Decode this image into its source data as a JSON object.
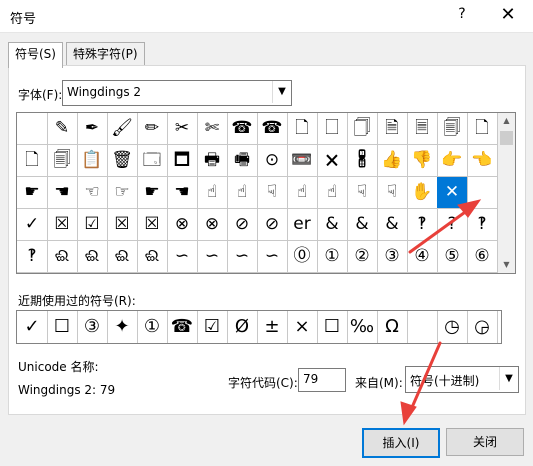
{
  "window": {
    "title": "符号",
    "help": "?",
    "close": "✕"
  },
  "tabs": [
    {
      "label": "符号(S)"
    },
    {
      "label": "特殊字符(P)"
    }
  ],
  "font": {
    "label": "字体(F):",
    "value": "Wingdings 2"
  },
  "grid_rows": [
    [
      "",
      "✎",
      "✒",
      "🖌",
      "✏",
      "✂",
      "✄",
      "☎",
      "☎",
      "🗋",
      "🗌",
      "🗍",
      "🗎",
      "🗏",
      "🗐",
      "🗋"
    ],
    [
      "🗋",
      "🗐",
      "📋",
      "🗑",
      "🗔",
      "🗖",
      "🖶",
      "🖷",
      "⊙",
      "📼",
      "🗙",
      "🖁",
      "👍",
      "👎",
      "👉",
      "👈"
    ],
    [
      "☛",
      "☚",
      "☜",
      "☞",
      "☛",
      "☚",
      "☝",
      "☝",
      "☟",
      "☝",
      "☝",
      "☟",
      "☟",
      "✋",
      "✕",
      ""
    ],
    [
      "✓",
      "☒",
      "☑",
      "☒",
      "☒",
      "⊗",
      "⊗",
      "⊘",
      "⊘",
      "er",
      "&",
      "&",
      "&",
      "‽",
      "?",
      "‽"
    ],
    [
      "‽",
      "ଈ",
      "ଈ",
      "ଈ",
      "ଈ",
      "∽",
      "∽",
      "∽",
      "∽",
      "⓪",
      "①",
      "②",
      "③",
      "④",
      "⑤",
      "⑥"
    ]
  ],
  "recent": {
    "label": "近期使用过的符号(R):",
    "symbols": [
      "✓",
      "☐",
      "③",
      "✦",
      "①",
      "☎",
      "☑",
      "Ø",
      "±",
      "×",
      "☐",
      "‰",
      "Ω",
      "",
      "◷",
      "◶"
    ]
  },
  "unicode": {
    "name_label": "Unicode 名称:",
    "name_value": "Wingdings 2: 79"
  },
  "char_code": {
    "label": "字符代码(C):",
    "value": "79"
  },
  "from": {
    "label": "来自(M):",
    "value": "符号(十进制)"
  },
  "buttons": {
    "insert": "插入(I)",
    "close": "关闭"
  },
  "colors": {
    "selection": "#0078d7",
    "annotation": "#e8403a"
  }
}
